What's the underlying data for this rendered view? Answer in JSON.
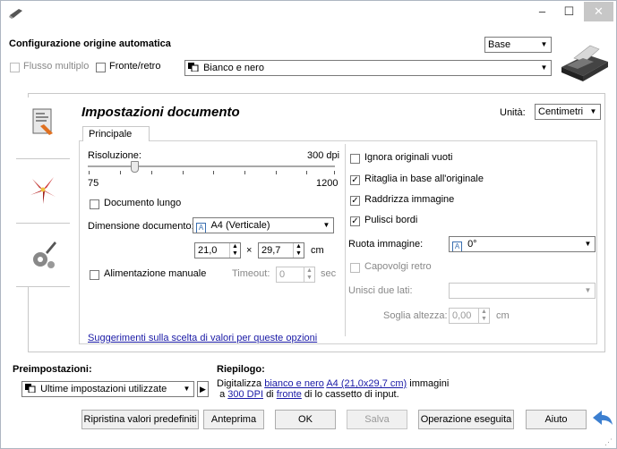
{
  "header": {
    "title": "Configurazione origine automatica",
    "mode_select": "Base",
    "flusso_label": "Flusso multiplo",
    "fronte_label": "Fronte/retro",
    "color_mode": "Bianco e nero"
  },
  "document": {
    "heading": "Impostazioni documento",
    "units_label": "Unità:",
    "units_value": "Centimetri",
    "tab_label": "Principale",
    "resolution_label": "Risoluzione:",
    "resolution_value": "300 dpi",
    "resolution_min": "75",
    "resolution_max": "1200",
    "resolution_fraction": 0.19,
    "long_doc_label": "Documento lungo",
    "size_label": "Dimensione documento:",
    "size_value": "A4 (Verticale)",
    "width_value": "21,0",
    "times": "×",
    "height_value": "29,7",
    "unit_cm": "cm",
    "manual_feed_label": "Alimentazione manuale",
    "timeout_label": "Timeout:",
    "timeout_value": "0",
    "timeout_unit": "sec",
    "ignore_blank_label": "Ignora originali vuoti",
    "crop_label": "Ritaglia in base all'originale",
    "straighten_label": "Raddrizza immagine",
    "clean_edges_label": "Pulisci bordi",
    "rotate_label": "Ruota immagine:",
    "rotate_value": "0°",
    "flip_back_label": "Capovolgi retro",
    "merge_label": "Unisci due lati:",
    "merge_value": "",
    "height_threshold_label": "Soglia altezza:",
    "height_threshold_value": "0,00",
    "height_threshold_unit": "cm",
    "tips_link": "Suggerimenti sulla scelta di valori per queste opzioni"
  },
  "presets": {
    "label": "Preimpostazioni:",
    "value": "Ultime impostazioni utilizzate"
  },
  "summary": {
    "label": "Riepilogo:",
    "t1": "Digitalizza",
    "l1": "bianco e nero",
    "l2": "A4 (21,0x29,7 cm)",
    "t2": "immagini",
    "t3": "a",
    "l3": "300 DPI",
    "t4": "di",
    "l4": "fronte",
    "t5": "di lo cassetto di input."
  },
  "buttons": {
    "reset": "Ripristina valori predefiniti",
    "preview": "Anteprima",
    "ok": "OK",
    "save": "Salva",
    "done": "Operazione eseguita",
    "help": "Aiuto"
  },
  "colors": {
    "accent": "#3c7fd0",
    "link": "#1a1aa6"
  }
}
